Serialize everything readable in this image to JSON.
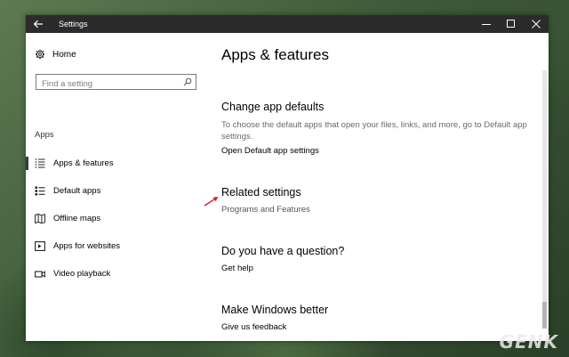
{
  "window": {
    "title": "Settings"
  },
  "sidebar": {
    "home_label": "Home",
    "search": {
      "placeholder": "Find a setting"
    },
    "section_label": "Apps",
    "items": [
      {
        "label": "Apps & features",
        "icon": "apps-features-icon",
        "active": true
      },
      {
        "label": "Default apps",
        "icon": "default-apps-icon",
        "active": false
      },
      {
        "label": "Offline maps",
        "icon": "map-icon",
        "active": false
      },
      {
        "label": "Apps for websites",
        "icon": "web-apps-icon",
        "active": false
      },
      {
        "label": "Video playback",
        "icon": "video-icon",
        "active": false
      }
    ]
  },
  "main": {
    "page_title": "Apps & features",
    "change_defaults": {
      "heading": "Change app defaults",
      "description": "To choose the default apps that open your files, links, and more, go to Default app settings.",
      "link": "Open Default app settings"
    },
    "related": {
      "heading": "Related settings",
      "link": "Programs and Features"
    },
    "question": {
      "heading": "Do you have a question?",
      "link": "Get help"
    },
    "better": {
      "heading": "Make Windows better",
      "link": "Give us feedback"
    }
  },
  "colors": {
    "titlebar": "#2b2b2b",
    "annotation_arrow": "#e02020"
  },
  "watermark": "GENK"
}
